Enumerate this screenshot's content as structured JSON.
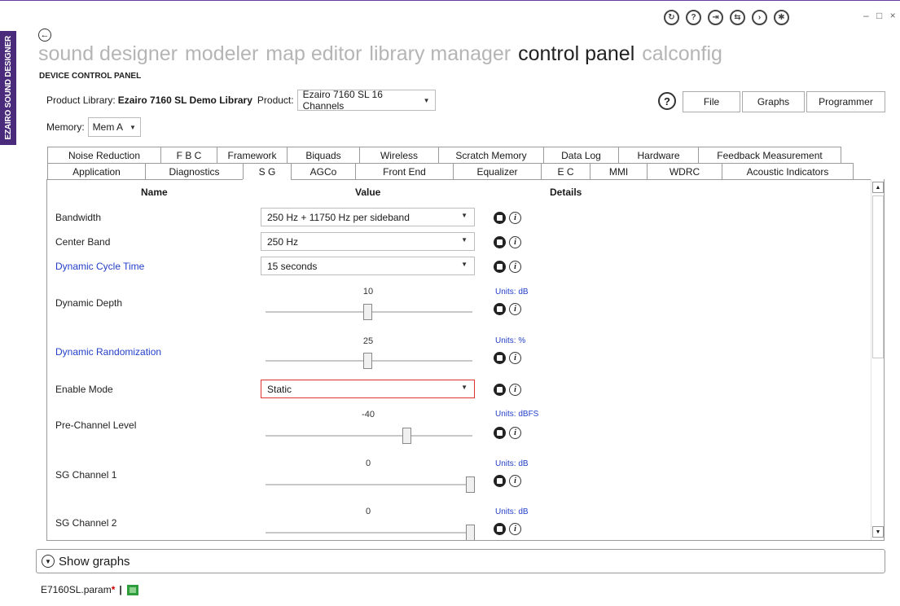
{
  "app": {
    "side_label": "EZAIRO SOUND DESIGNER"
  },
  "top_icons": [
    "refresh-icon",
    "help-circle-icon",
    "login-icon",
    "sync-icon",
    "terminal-icon",
    "settings-icon"
  ],
  "window_controls": "– □ ×",
  "nav": {
    "items": [
      {
        "label": "sound designer",
        "active": false
      },
      {
        "label": "modeler",
        "active": false
      },
      {
        "label": "map editor",
        "active": false
      },
      {
        "label": "library manager",
        "active": false
      },
      {
        "label": "control panel",
        "active": true
      },
      {
        "label": "calconfig",
        "active": false
      }
    ]
  },
  "subtitle": "DEVICE CONTROL PANEL",
  "product": {
    "library_label": "Product Library:",
    "library_value": "Ezairo 7160 SL Demo Library",
    "product_label": "Product:",
    "product_value": "Ezairo 7160 SL 16 Channels"
  },
  "memory": {
    "label": "Memory:",
    "value": "Mem A"
  },
  "buttons": {
    "file": "File",
    "graphs": "Graphs",
    "programmer": "Programmer",
    "help": "?"
  },
  "tabs_row1": [
    "Noise Reduction",
    "F B C",
    "Framework",
    "Biquads",
    "Wireless",
    "Scratch Memory",
    "Data Log",
    "Hardware",
    "Feedback Measurement"
  ],
  "tabs_row2": [
    "Application",
    "Diagnostics",
    "S G",
    "AGCo",
    "Front End",
    "Equalizer",
    "E C",
    "MMI",
    "WDRC",
    "Acoustic Indicators"
  ],
  "active_tab": "S G",
  "columns": {
    "name": "Name",
    "value": "Value",
    "details": "Details"
  },
  "rows": {
    "bandwidth": {
      "name": "Bandwidth",
      "value": "250 Hz + 11750 Hz per sideband"
    },
    "center_band": {
      "name": "Center Band",
      "value": "250 Hz"
    },
    "cycle_time": {
      "name": "Dynamic Cycle Time",
      "value": "15 seconds"
    },
    "depth": {
      "name": "Dynamic Depth",
      "value": "10",
      "units": "Units: dB"
    },
    "randomization": {
      "name": "Dynamic Randomization",
      "value": "25",
      "units": "Units: %"
    },
    "enable_mode": {
      "name": "Enable Mode",
      "value": "Static"
    },
    "pre_level": {
      "name": "Pre-Channel Level",
      "value": "-40",
      "units": "Units: dBFS"
    },
    "sg1": {
      "name": "SG Channel 1",
      "value": "0",
      "units": "Units: dB"
    },
    "sg2": {
      "name": "SG Channel 2",
      "value": "0",
      "units": "Units: dB"
    }
  },
  "show_graphs": "Show graphs",
  "status": {
    "filename": "E7160SL.param",
    "modified": "*",
    "separator": "|"
  }
}
